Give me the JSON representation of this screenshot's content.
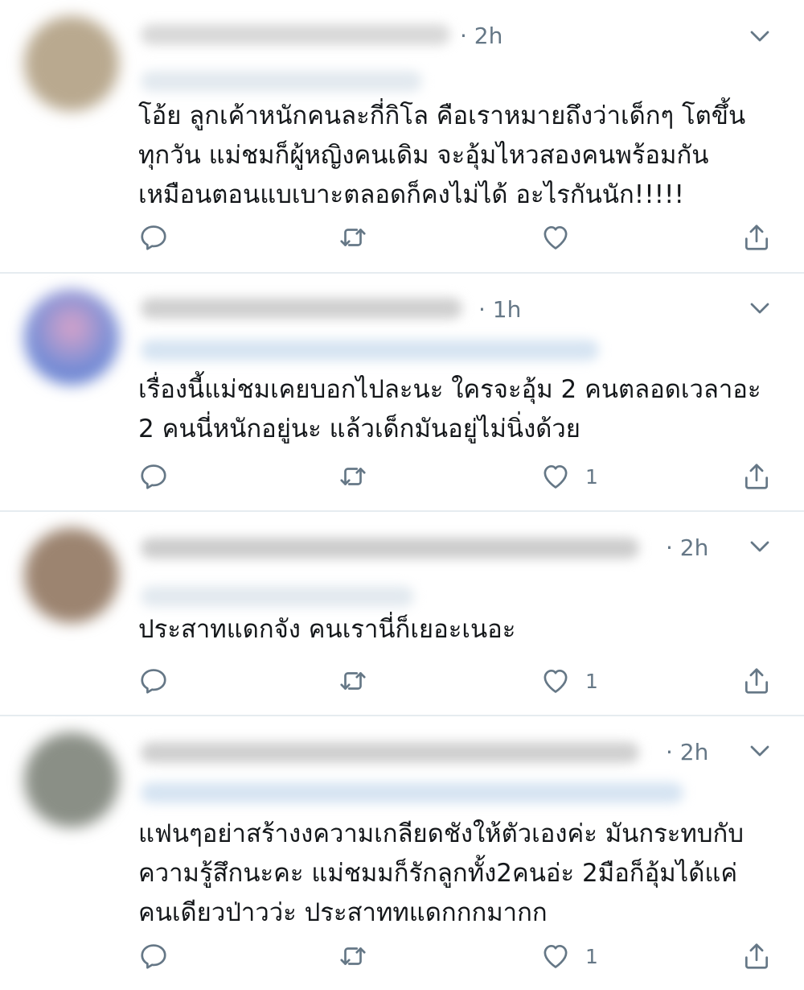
{
  "colors": {
    "icon": "#657786",
    "text": "#14171a",
    "divider": "#e6ecf0"
  },
  "icons": {
    "reply": "reply-icon",
    "retweet": "retweet-icon",
    "like": "heart-icon",
    "share": "share-icon",
    "more": "chevron-down-icon"
  },
  "tweets": [
    {
      "time": "· 2h",
      "text": "โอ้ย ลูกเค้าหนักคนละกี่กิโล คือเราหมายถึงว่าเด็กๆ โตขึ้น\nทุกวัน แม่ชมก็ผู้หญิงคนเดิม จะอุ้มไหวสองคนพร้อมกัน\nเหมือนตอนแบเบาะตลอดก็คงไม่ได้ อะไรกันนัก!!!!!",
      "likes": ""
    },
    {
      "time": "· 1h",
      "text": "เรื่องนี้แม่ชมเคยบอกไปละนะ ใครจะอุ้ม 2 คนตลอดเวลาอะ\n2 คนนี่หนักอยู่นะ แล้วเด็กมันอยู่ไม่นิ่งด้วย",
      "likes": "1"
    },
    {
      "time": "· 2h",
      "text": "ประสาทแดกจัง คนเรานี่ก็เยอะเนอะ",
      "likes": "1"
    },
    {
      "time": "· 2h",
      "text": "แฟนๆอย่าสร้างงความเกลียดชังให้ตัวเองค่ะ มันกระทบกับ\nความรู้สึกนะคะ แม่ชมมก็รักลูกทั้ง2คนอ่ะ 2มือก็อุ้มได้แค่\nคนเดียวป่าวว่ะ ประสาททแดกกกมากก",
      "likes": "1"
    }
  ]
}
